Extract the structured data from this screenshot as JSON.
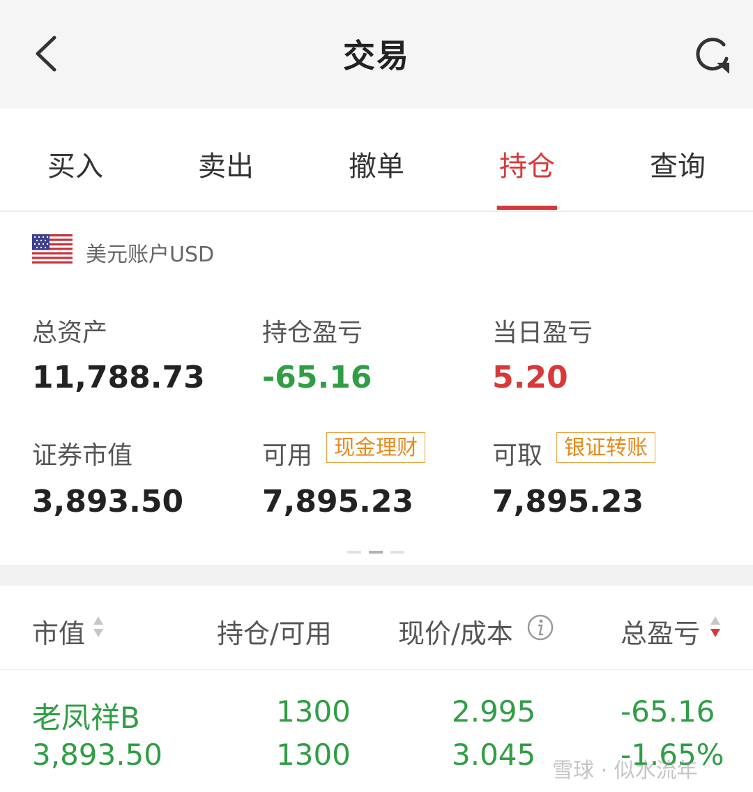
{
  "header": {
    "title": "交易",
    "back_icon": "chevron-left-icon",
    "refresh_icon": "refresh-icon"
  },
  "tabs": [
    {
      "label": "买入"
    },
    {
      "label": "卖出"
    },
    {
      "label": "撤单"
    },
    {
      "label": "持仓",
      "active": true
    },
    {
      "label": "查询"
    }
  ],
  "account": {
    "flag_icon": "us-flag-icon",
    "label": "美元账户USD",
    "metrics": {
      "total_assets": {
        "label": "总资产",
        "value": "11,788.73"
      },
      "position_pl": {
        "label": "持仓盈亏",
        "value": "-65.16"
      },
      "daily_pl": {
        "label": "当日盈亏",
        "value": "5.20"
      },
      "securities_value": {
        "label": "证券市值",
        "value": "3,893.50"
      },
      "available": {
        "label": "可用",
        "value": "7,895.23",
        "button": "现金理财"
      },
      "withdrawable": {
        "label": "可取",
        "value": "7,895.23",
        "button": "银证转账"
      }
    },
    "page_indicator": {
      "pages": 3,
      "current": 2
    }
  },
  "holdings_table": {
    "columns": [
      "市值",
      "持仓/可用",
      "现价/成本",
      "总盈亏"
    ],
    "rows": [
      {
        "name": "老凤祥B",
        "market_value": "3,893.50",
        "position": "1300",
        "available": "1300",
        "current_price": "2.995",
        "cost": "3.045",
        "total_pl": "-65.16",
        "total_pl_pct": "-1.65%"
      }
    ]
  },
  "colors": {
    "accent_red": "#d83838",
    "profit_red": "#d83838",
    "loss_green": "#2f9e45",
    "tag_orange": "#e68a1c"
  },
  "watermark": "雪球 · 似水流年"
}
